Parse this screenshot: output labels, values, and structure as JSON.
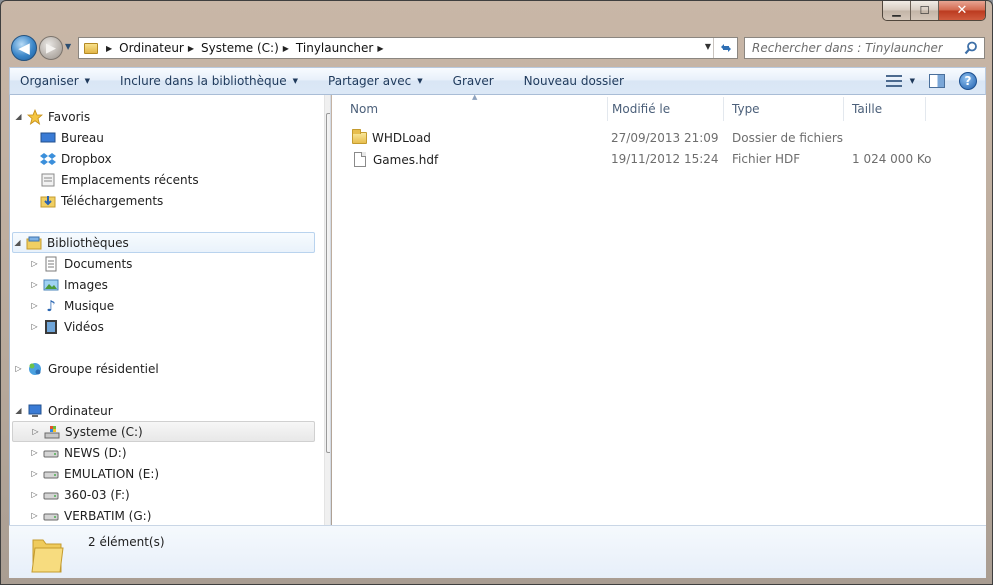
{
  "window": {
    "minimize_glyph": "▁",
    "maximize_glyph": "☐",
    "close_glyph": "✕"
  },
  "navigation": {
    "back_glyph": "◀",
    "forward_glyph": "▶",
    "breadcrumb": [
      "Ordinateur",
      "Systeme (C:)",
      "Tinylauncher"
    ],
    "search_placeholder": "Rechercher dans : Tinylauncher"
  },
  "commands": [
    {
      "label": "Organiser",
      "dropdown": true
    },
    {
      "label": "Inclure dans la bibliothèque",
      "dropdown": true
    },
    {
      "label": "Partager avec",
      "dropdown": true
    },
    {
      "label": "Graver",
      "dropdown": false
    },
    {
      "label": "Nouveau dossier",
      "dropdown": false
    }
  ],
  "tree": {
    "favorites": {
      "label": "Favoris",
      "items": [
        "Bureau",
        "Dropbox",
        "Emplacements récents",
        "Téléchargements"
      ]
    },
    "libraries": {
      "label": "Bibliothèques",
      "items": [
        "Documents",
        "Images",
        "Musique",
        "Vidéos"
      ]
    },
    "homegroup": {
      "label": "Groupe résidentiel"
    },
    "computer": {
      "label": "Ordinateur",
      "items": [
        "Systeme (C:)",
        "NEWS (D:)",
        "EMULATION (E:)",
        "360-03 (F:)",
        "VERBATIM (G:)"
      ]
    }
  },
  "columns": [
    "Nom",
    "Modifié le",
    "Type",
    "Taille"
  ],
  "files": [
    {
      "name": "WHDLoad",
      "modified": "27/09/2013 21:09",
      "type": "Dossier de fichiers",
      "size": "",
      "kind": "folder"
    },
    {
      "name": "Games.hdf",
      "modified": "19/11/2012 15:24",
      "type": "Fichier HDF",
      "size": "1 024 000 Ko",
      "kind": "file"
    }
  ],
  "status": {
    "count_text": "2 élément(s)"
  },
  "colors": {
    "accent": "#1e395b",
    "selection_border": "#b9d3ee"
  }
}
